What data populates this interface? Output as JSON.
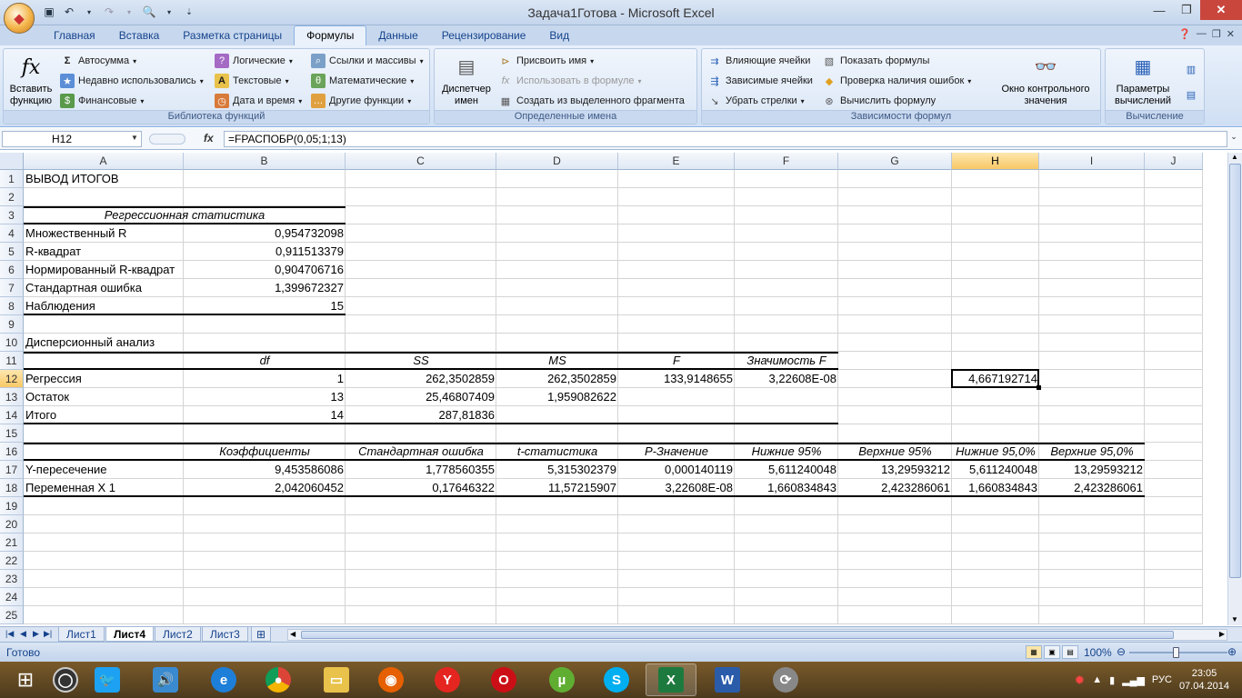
{
  "window": {
    "title": "Задача1Готова - Microsoft Excel"
  },
  "tabs": [
    {
      "label": "Главная"
    },
    {
      "label": "Вставка"
    },
    {
      "label": "Разметка страницы"
    },
    {
      "label": "Формулы",
      "active": true
    },
    {
      "label": "Данные"
    },
    {
      "label": "Рецензирование"
    },
    {
      "label": "Вид"
    }
  ],
  "ribbon": {
    "func_library": {
      "title": "Библиотека функций",
      "insert_function": "Вставить функцию",
      "autosum": "Автосумма",
      "recent": "Недавно использовались",
      "financial": "Финансовые",
      "logical": "Логические",
      "text": "Текстовые",
      "datetime": "Дата и время",
      "lookup": "Ссылки и массивы",
      "math": "Математические",
      "other": "Другие функции"
    },
    "defined_names": {
      "title": "Определенные имена",
      "manager": "Диспетчер имен",
      "define": "Присвоить имя",
      "use": "Использовать в формуле",
      "create": "Создать из выделенного фрагмента"
    },
    "auditing": {
      "title": "Зависимости формул",
      "precedents": "Влияющие ячейки",
      "dependents": "Зависимые ячейки",
      "remove_arrows": "Убрать стрелки",
      "show_formulas": "Показать формулы",
      "error_check": "Проверка наличия ошибок",
      "evaluate": "Вычислить формулу",
      "watch": "Окно контрольного значения"
    },
    "calculation": {
      "title": "Вычисление",
      "options": "Параметры вычислений"
    }
  },
  "formula_bar": {
    "name_box": "H12",
    "formula": "=FРАСПОБР(0,05;1;13)"
  },
  "columns": [
    "A",
    "B",
    "C",
    "D",
    "E",
    "F",
    "G",
    "H",
    "I",
    "J"
  ],
  "rows": [
    "1",
    "2",
    "3",
    "4",
    "5",
    "6",
    "7",
    "8",
    "9",
    "10",
    "11",
    "12",
    "13",
    "14",
    "15",
    "16",
    "17",
    "18",
    "19",
    "20",
    "21",
    "22",
    "23",
    "24",
    "25"
  ],
  "sheet": {
    "r1": {
      "A": "ВЫВОД ИТОГОВ"
    },
    "r3": {
      "A": "Регрессионная статистика"
    },
    "r4": {
      "A": "Множественный R",
      "B": "0,954732098"
    },
    "r5": {
      "A": "R-квадрат",
      "B": "0,911513379"
    },
    "r6": {
      "A": "Нормированный R-квадрат",
      "B": "0,904706716"
    },
    "r7": {
      "A": "Стандартная ошибка",
      "B": "1,399672327"
    },
    "r8": {
      "A": "Наблюдения",
      "B": "15"
    },
    "r10": {
      "A": "Дисперсионный анализ"
    },
    "r11": {
      "B": "df",
      "C": "SS",
      "D": "MS",
      "E": "F",
      "F": "Значимость F"
    },
    "r12": {
      "A": "Регрессия",
      "B": "1",
      "C": "262,3502859",
      "D": "262,3502859",
      "E": "133,9148655",
      "F": "3,22608E-08",
      "H": "4,667192714"
    },
    "r13": {
      "A": "Остаток",
      "B": "13",
      "C": "25,46807409",
      "D": "1,959082622"
    },
    "r14": {
      "A": "Итого",
      "B": "14",
      "C": "287,81836"
    },
    "r16": {
      "B": "Коэффициенты",
      "C": "Стандартная ошибка",
      "D": "t-статистика",
      "E": "P-Значение",
      "F": "Нижние 95%",
      "G": "Верхние 95%",
      "H": "Нижние 95,0%",
      "I": "Верхние 95,0%"
    },
    "r17": {
      "A": "Y-пересечение",
      "B": "9,453586086",
      "C": "1,778560355",
      "D": "5,315302379",
      "E": "0,000140119",
      "F": "5,611240048",
      "G": "13,29593212",
      "H": "5,611240048",
      "I": "13,29593212"
    },
    "r18": {
      "A": "Переменная X 1",
      "B": "2,042060452",
      "C": "0,17646322",
      "D": "11,57215907",
      "E": "3,22608E-08",
      "F": "1,660834843",
      "G": "2,423286061",
      "H": "1,660834843",
      "I": "2,423286061"
    }
  },
  "sheet_tabs": [
    {
      "label": "Лист1"
    },
    {
      "label": "Лист4",
      "active": true
    },
    {
      "label": "Лист2"
    },
    {
      "label": "Лист3"
    }
  ],
  "status": {
    "ready": "Готово",
    "zoom": "100%"
  },
  "tray": {
    "lang": "РУС",
    "time": "23:05",
    "date": "07.04.2014"
  }
}
